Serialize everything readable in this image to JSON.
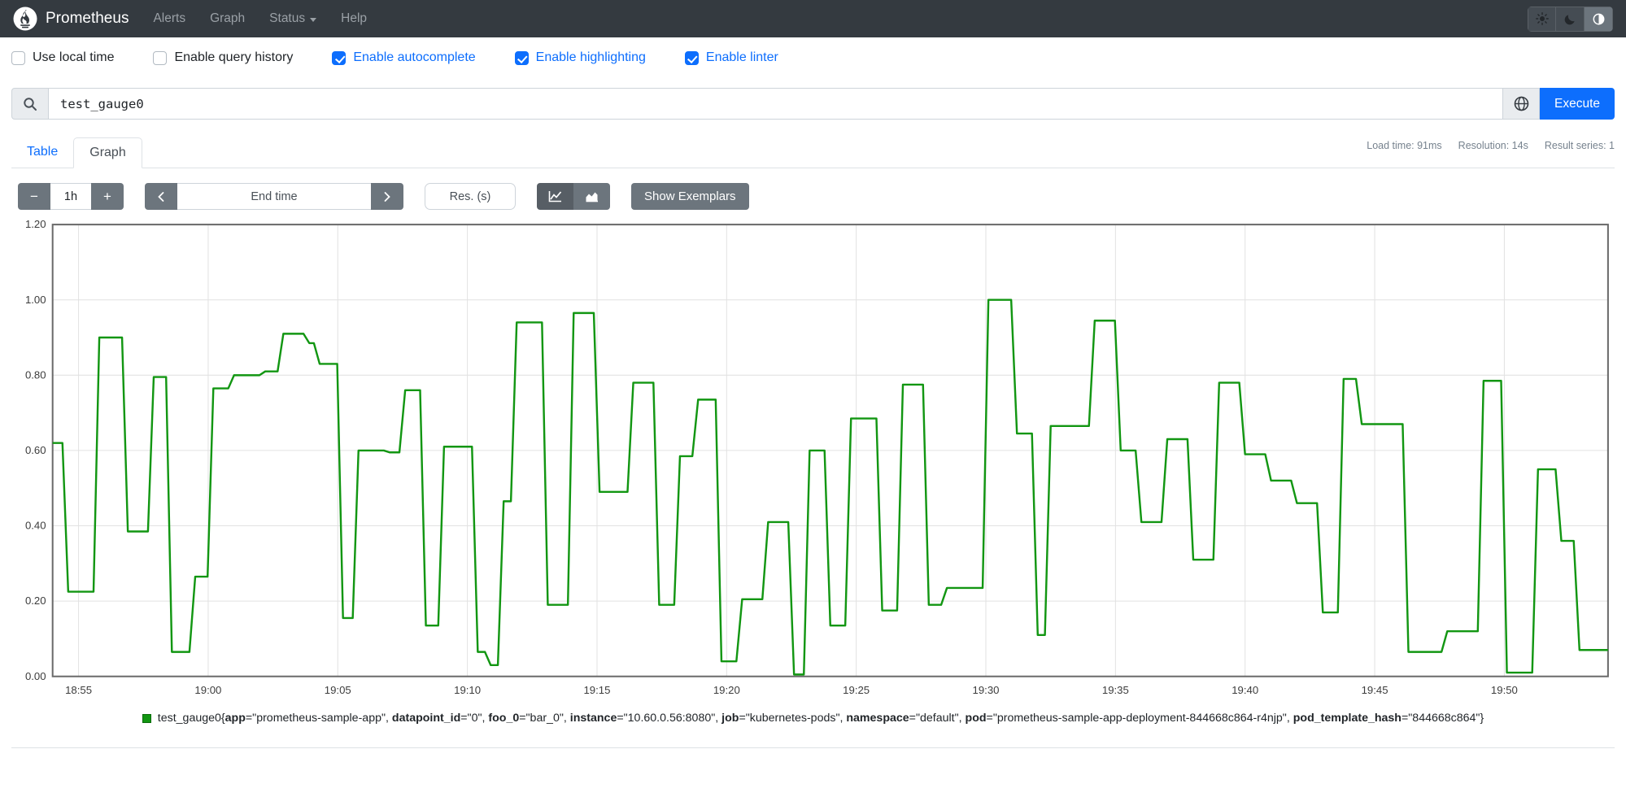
{
  "colors": {
    "accent": "#0d6efd",
    "navbar_bg": "#343a40",
    "series_green": "#129612",
    "swatch_border": "#0b6b0b",
    "secondary_btn": "#6c757d"
  },
  "navbar": {
    "brand": "Prometheus",
    "links": [
      {
        "label": "Alerts"
      },
      {
        "label": "Graph"
      },
      {
        "label": "Status",
        "dropdown": true
      },
      {
        "label": "Help"
      }
    ],
    "theme_buttons": [
      {
        "icon": "sun-icon",
        "active": false
      },
      {
        "icon": "moon-icon",
        "active": false
      },
      {
        "icon": "circle-half-icon",
        "active": true
      }
    ]
  },
  "options": [
    {
      "label": "Use local time",
      "checked": false
    },
    {
      "label": "Enable query history",
      "checked": false
    },
    {
      "label": "Enable autocomplete",
      "checked": true
    },
    {
      "label": "Enable highlighting",
      "checked": true
    },
    {
      "label": "Enable linter",
      "checked": true
    }
  ],
  "query": {
    "value": "test_gauge0",
    "execute_label": "Execute",
    "icons": [
      "search-icon",
      "globe-icon"
    ]
  },
  "tabs": [
    {
      "label": "Table",
      "active": false
    },
    {
      "label": "Graph",
      "active": true
    }
  ],
  "stats": {
    "items": [
      "Load time: 91ms",
      "Resolution: 14s",
      "Result series: 1"
    ]
  },
  "controls": {
    "minus": "−",
    "plus": "+",
    "range": "1h",
    "prev": "‹",
    "next": "›",
    "end_time_placeholder": "End time",
    "res_placeholder": "Res. (s)",
    "show_exemplars": "Show Exemplars",
    "chart_type_icons": [
      "line-chart-icon",
      "stacked-chart-icon"
    ]
  },
  "chart_data": {
    "type": "line",
    "step": true,
    "series": [
      {
        "name": "test_gauge0",
        "color": "#129612"
      }
    ],
    "xlim": [
      0,
      60
    ],
    "ylim": [
      0,
      1.2
    ],
    "grid": true,
    "x_start_time": "18:54",
    "xticks": [
      {
        "m": 1,
        "label": "18:55"
      },
      {
        "m": 6,
        "label": "19:00"
      },
      {
        "m": 11,
        "label": "19:05"
      },
      {
        "m": 16,
        "label": "19:10"
      },
      {
        "m": 21,
        "label": "19:15"
      },
      {
        "m": 26,
        "label": "19:20"
      },
      {
        "m": 31,
        "label": "19:25"
      },
      {
        "m": 36,
        "label": "19:30"
      },
      {
        "m": 41,
        "label": "19:35"
      },
      {
        "m": 46,
        "label": "19:40"
      },
      {
        "m": 51,
        "label": "19:45"
      },
      {
        "m": 56,
        "label": "19:50"
      }
    ],
    "yticks": [
      0,
      0.2,
      0.4,
      0.6,
      0.8,
      1.0,
      1.2
    ],
    "points": [
      [
        0.0,
        0.62
      ],
      [
        0.6,
        0.225
      ],
      [
        1.8,
        0.9
      ],
      [
        2.9,
        0.385
      ],
      [
        3.9,
        0.795
      ],
      [
        4.6,
        0.065
      ],
      [
        5.5,
        0.265
      ],
      [
        6.2,
        0.765
      ],
      [
        7.0,
        0.8
      ],
      [
        8.2,
        0.81
      ],
      [
        8.9,
        0.91
      ],
      [
        9.9,
        0.885
      ],
      [
        10.3,
        0.83
      ],
      [
        11.2,
        0.155
      ],
      [
        11.8,
        0.6
      ],
      [
        13.0,
        0.595
      ],
      [
        13.6,
        0.76
      ],
      [
        14.4,
        0.135
      ],
      [
        15.1,
        0.61
      ],
      [
        16.4,
        0.065
      ],
      [
        16.9,
        0.03
      ],
      [
        17.4,
        0.465
      ],
      [
        17.9,
        0.94
      ],
      [
        19.1,
        0.19
      ],
      [
        20.1,
        0.965
      ],
      [
        21.1,
        0.49
      ],
      [
        22.4,
        0.78
      ],
      [
        23.4,
        0.19
      ],
      [
        24.2,
        0.585
      ],
      [
        24.9,
        0.735
      ],
      [
        25.8,
        0.04
      ],
      [
        26.6,
        0.205
      ],
      [
        27.6,
        0.41
      ],
      [
        28.6,
        0.005
      ],
      [
        29.2,
        0.6
      ],
      [
        30.0,
        0.135
      ],
      [
        30.8,
        0.685
      ],
      [
        32.0,
        0.175
      ],
      [
        32.8,
        0.775
      ],
      [
        33.8,
        0.19
      ],
      [
        34.5,
        0.235
      ],
      [
        36.1,
        1.0
      ],
      [
        37.2,
        0.645
      ],
      [
        38.0,
        0.11
      ],
      [
        38.5,
        0.665
      ],
      [
        40.2,
        0.945
      ],
      [
        41.2,
        0.6
      ],
      [
        42.0,
        0.41
      ],
      [
        43.0,
        0.63
      ],
      [
        44.0,
        0.31
      ],
      [
        45.0,
        0.78
      ],
      [
        46.0,
        0.59
      ],
      [
        47.0,
        0.52
      ],
      [
        48.0,
        0.46
      ],
      [
        49.0,
        0.17
      ],
      [
        49.8,
        0.79
      ],
      [
        50.5,
        0.67
      ],
      [
        52.3,
        0.065
      ],
      [
        53.8,
        0.12
      ],
      [
        55.2,
        0.785
      ],
      [
        56.1,
        0.01
      ],
      [
        57.3,
        0.55
      ],
      [
        58.2,
        0.36
      ],
      [
        58.9,
        0.07
      ]
    ]
  },
  "legend": {
    "metric": "test_gauge0",
    "labels": [
      {
        "name": "app",
        "value": "prometheus-sample-app"
      },
      {
        "name": "datapoint_id",
        "value": "0"
      },
      {
        "name": "foo_0",
        "value": "bar_0"
      },
      {
        "name": "instance",
        "value": "10.60.0.56:8080"
      },
      {
        "name": "job",
        "value": "kubernetes-pods"
      },
      {
        "name": "namespace",
        "value": "default"
      },
      {
        "name": "pod",
        "value": "prometheus-sample-app-deployment-844668c864-r4njp"
      },
      {
        "name": "pod_template_hash",
        "value": "844668c864"
      }
    ]
  }
}
